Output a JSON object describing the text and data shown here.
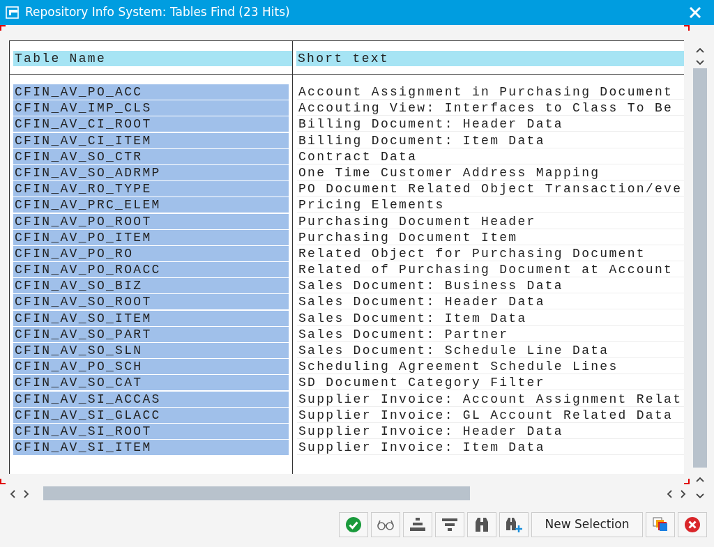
{
  "window": {
    "title": "Repository Info System: Tables Find (23 Hits)"
  },
  "table": {
    "columns": [
      "Table Name",
      "Short text"
    ],
    "rows": [
      {
        "name": "CFIN_AV_PO_ACC",
        "text": "Account Assignment in Purchasing Document",
        "selected": true
      },
      {
        "name": "CFIN_AV_IMP_CLS",
        "text": "Accouting View: Interfaces to Class To Be",
        "selected": true
      },
      {
        "name": "CFIN_AV_CI_ROOT",
        "text": "Billing Document: Header Data",
        "selected": true
      },
      {
        "name": "CFIN_AV_CI_ITEM",
        "text": "Billing Document: Item Data",
        "selected": true
      },
      {
        "name": "CFIN_AV_SO_CTR",
        "text": "Contract Data",
        "selected": true
      },
      {
        "name": "CFIN_AV_SO_ADRMP",
        "text": "One Time Customer Address Mapping",
        "selected": true
      },
      {
        "name": "CFIN_AV_RO_TYPE",
        "text": "PO Document Related Object Transaction/eve",
        "selected": true
      },
      {
        "name": "CFIN_AV_PRC_ELEM",
        "text": "Pricing Elements",
        "selected": true
      },
      {
        "name": "CFIN_AV_PO_ROOT",
        "text": "Purchasing Document Header",
        "selected": true
      },
      {
        "name": "CFIN_AV_PO_ITEM",
        "text": "Purchasing Document Item",
        "selected": true
      },
      {
        "name": "CFIN_AV_PO_RO",
        "text": "Related Object for Purchasing Document",
        "selected": true
      },
      {
        "name": "CFIN_AV_PO_ROACC",
        "text": "Related of Purchasing Document at Account",
        "selected": true
      },
      {
        "name": "CFIN_AV_SO_BIZ",
        "text": "Sales Document: Business Data",
        "selected": true
      },
      {
        "name": "CFIN_AV_SO_ROOT",
        "text": "Sales Document: Header Data",
        "selected": true
      },
      {
        "name": "CFIN_AV_SO_ITEM",
        "text": "Sales Document: Item Data",
        "selected": true
      },
      {
        "name": "CFIN_AV_SO_PART",
        "text": "Sales Document: Partner",
        "selected": true
      },
      {
        "name": "CFIN_AV_SO_SLN",
        "text": "Sales Document: Schedule Line Data",
        "selected": true
      },
      {
        "name": "CFIN_AV_PO_SCH",
        "text": "Scheduling Agreement Schedule Lines",
        "selected": true
      },
      {
        "name": "CFIN_AV_SO_CAT",
        "text": "SD Document Category Filter",
        "selected": true
      },
      {
        "name": "CFIN_AV_SI_ACCAS",
        "text": "Supplier Invoice: Account Assignment Relat",
        "selected": true
      },
      {
        "name": "CFIN_AV_SI_GLACC",
        "text": "Supplier Invoice: GL Account Related Data",
        "selected": true
      },
      {
        "name": "CFIN_AV_SI_ROOT",
        "text": "Supplier Invoice: Header Data",
        "selected": true
      },
      {
        "name": "CFIN_AV_SI_ITEM",
        "text": "Supplier Invoice: Item Data",
        "selected": true
      }
    ]
  },
  "toolbar": [
    {
      "kind": "icon"
    },
    {
      "kind": "icon"
    },
    {
      "kind": "icon"
    },
    {
      "kind": "icon"
    },
    {
      "kind": "icon"
    },
    {
      "kind": "icon"
    },
    {
      "kind": "text",
      "label": "New Selection"
    },
    {
      "kind": "icon"
    },
    {
      "kind": "icon"
    }
  ]
}
